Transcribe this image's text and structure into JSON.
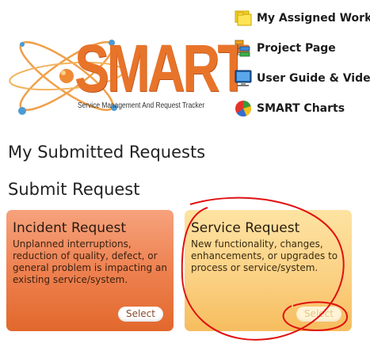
{
  "logo": {
    "word": "SMART",
    "tagline": "Service Management And Request Tracker",
    "icon": "atom-logo-icon"
  },
  "links": [
    {
      "label": "My Assigned Work",
      "icon": "folders-icon"
    },
    {
      "label": "Project Page",
      "icon": "hierarchy-icon"
    },
    {
      "label": "User Guide & Video",
      "icon": "monitor-icon"
    },
    {
      "label": "SMART Charts",
      "icon": "pie-chart-icon"
    }
  ],
  "headings": {
    "submitted": "My Submitted Requests",
    "submit": "Submit Request"
  },
  "cards": {
    "incident": {
      "title": "Incident Request",
      "description": "Unplanned interruptions, reduction of quality, defect, or general problem is impacting an existing service/system.",
      "button": "Select"
    },
    "service": {
      "title": "Service Request",
      "description": "New functionality, changes, enhancements, or upgrades to process or service/system.",
      "button": "Select"
    }
  },
  "colors": {
    "accent_orange": "#e8742a",
    "annotation_red": "#e01010",
    "incident_card": "#ee8150",
    "service_card": "#fbd184"
  }
}
